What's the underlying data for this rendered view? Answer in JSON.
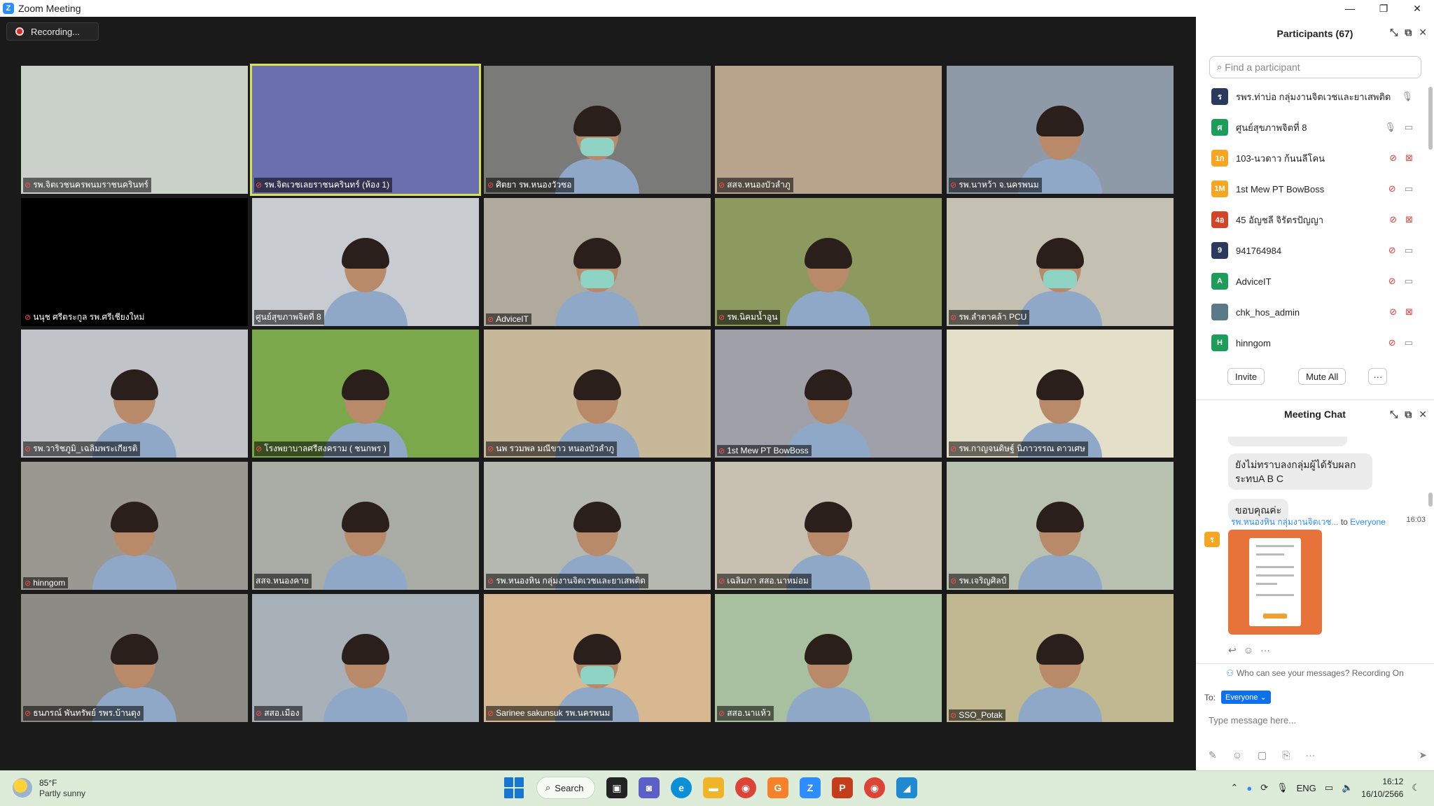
{
  "window": {
    "title": "Zoom Meeting",
    "controls": [
      "—",
      "❐",
      "✕"
    ]
  },
  "recording": {
    "label": "Recording..."
  },
  "tiles": [
    {
      "name": "รพ.จิตเวชนครพนมราชนครินทร์",
      "muted": true,
      "bg": "#c9d1c8",
      "person": false,
      "active": false
    },
    {
      "name": "รพ.จิตเวชเลยราชนครินทร์ (ห้อง 1)",
      "muted": true,
      "bg": "#6a6fb0",
      "person": false,
      "active": true
    },
    {
      "name": "ศิตยา รพ.หนองวัวซอ",
      "muted": true,
      "bg": "#7a7a78",
      "person": true,
      "mask": true,
      "active": false
    },
    {
      "name": "สสจ.หนองบัวลำภู",
      "muted": true,
      "bg": "#b8a48c",
      "person": false,
      "active": false
    },
    {
      "name": "รพ.นาหว้า จ.นครพนม",
      "muted": true,
      "bg": "#8f9aa8",
      "person": true,
      "mask": false,
      "active": false
    },
    {
      "name": "นนุช ศรีตระกูล รพ.ศรีเชียงใหม่",
      "muted": true,
      "bg": "#000000",
      "person": false,
      "active": false
    },
    {
      "name": "ศูนย์สุขภาพจิตที่ 8",
      "muted": false,
      "bg": "#c8ccd0",
      "person": true,
      "mask": false,
      "active": false
    },
    {
      "name": "AdviceIT",
      "muted": true,
      "bg": "#b0aa9c",
      "person": true,
      "mask": true,
      "active": false
    },
    {
      "name": "รพ.นิคมน้ำอูน",
      "muted": true,
      "bg": "#8c9a60",
      "person": true,
      "mask": false,
      "active": false
    },
    {
      "name": "รพ.ลำตาคล้า PCU",
      "muted": true,
      "bg": "#c4c0b2",
      "person": true,
      "mask": true,
      "active": false
    },
    {
      "name": "รพ.วาริชภูมิ_เฉลิมพระเกียรติ",
      "muted": true,
      "bg": "#c0c4c8",
      "person": true,
      "mask": false,
      "active": false
    },
    {
      "name": "โรงพยาบาลศรีสงคราม ( ชนกพร )",
      "muted": true,
      "bg": "#7aa84a",
      "person": true,
      "mask": false,
      "active": false
    },
    {
      "name": "นพ รวมพล มณีขาว หนองบัวลำภู",
      "muted": true,
      "bg": "#c8b89a",
      "person": true,
      "mask": false,
      "active": false
    },
    {
      "name": "1st Mew PT BowBoss",
      "muted": true,
      "bg": "#a0a0a8",
      "person": true,
      "mask": false,
      "active": false
    },
    {
      "name": "รพ.กาญจนดิษฐ์ นิภาวรรณ ดาวเศษ",
      "muted": true,
      "bg": "#e4dfc8",
      "person": true,
      "mask": false,
      "active": false
    },
    {
      "name": "hinngom",
      "muted": true,
      "bg": "#9a9890",
      "person": true,
      "mask": false,
      "active": false
    },
    {
      "name": "สสจ.หนองคาย",
      "muted": false,
      "bg": "#a8aca4",
      "person": true,
      "mask": false,
      "active": false
    },
    {
      "name": "รพ.หนองหิน กลุ่มงานจิตเวชและยาเสพติด",
      "muted": true,
      "bg": "#b4b8b0",
      "person": true,
      "mask": false,
      "active": false
    },
    {
      "name": "เฉลิมภา สสอ.นาหม่อม",
      "muted": true,
      "bg": "#c8c0b0",
      "person": true,
      "mask": false,
      "active": false
    },
    {
      "name": "รพ.เจริญศิลป์",
      "muted": true,
      "bg": "#b8c0b0",
      "person": true,
      "mask": false,
      "active": false
    },
    {
      "name": "ธนภรณ์ พันทรัพย์ รพร.บ้านดุง",
      "muted": true,
      "bg": "#8c8a84",
      "person": true,
      "mask": false,
      "active": false
    },
    {
      "name": "สสอ.เมือง",
      "muted": true,
      "bg": "#a8b0b8",
      "person": true,
      "mask": false,
      "active": false
    },
    {
      "name": "Sarinee sakunsuk รพ.นครพนม",
      "muted": true,
      "bg": "#d8b890",
      "person": true,
      "mask": true,
      "active": false
    },
    {
      "name": "สสอ.นาแห้ว",
      "muted": true,
      "bg": "#a8c0a0",
      "person": true,
      "mask": false,
      "active": false
    },
    {
      "name": "SSO_Potak",
      "muted": true,
      "bg": "#c0b890",
      "person": true,
      "mask": false,
      "active": false
    }
  ],
  "participants": {
    "title": "Participants (67)",
    "search_placeholder": "Find a participant",
    "list": [
      {
        "avatar": "ร",
        "color": "#2b3a5c",
        "name": "รพร.ท่าบ่อ กลุ่มงานจิตเวชและยาเสพติด",
        "mic": "on",
        "cam": "none"
      },
      {
        "avatar": "ศ",
        "color": "#1d9c5a",
        "name": "ศูนย์สุขภาพจิตที่ 8",
        "mic": "on",
        "cam": "on"
      },
      {
        "avatar": "1ก",
        "color": "#f5a623",
        "name": "103-นวดาว ก้นนลีโคน",
        "mic": "off",
        "cam": "off"
      },
      {
        "avatar": "1M",
        "color": "#f5a623",
        "name": "1st Mew PT BowBoss",
        "mic": "off",
        "cam": "on"
      },
      {
        "avatar": "4อ",
        "color": "#d0442a",
        "name": "45 อัญชลี จิรัตรปัญญา",
        "mic": "off",
        "cam": "off"
      },
      {
        "avatar": "9",
        "color": "#2b3a5c",
        "name": "941764984",
        "mic": "off",
        "cam": "on"
      },
      {
        "avatar": "A",
        "color": "#1d9c5a",
        "name": "AdviceIT",
        "mic": "off",
        "cam": "on"
      },
      {
        "avatar": "",
        "color": "#5a7a8a",
        "name": "chk_hos_admin",
        "mic": "off",
        "cam": "off"
      },
      {
        "avatar": "H",
        "color": "#1d9c5a",
        "name": "hinngom",
        "mic": "off",
        "cam": "on"
      }
    ],
    "invite_label": "Invite",
    "mute_all_label": "Mute All",
    "more_label": "···"
  },
  "chat": {
    "title": "Meeting Chat",
    "msg1": "ยังไม่ทราบลงกลุ่มผู้ได้รับผลกระทบA B C",
    "msg2": "ขอบคุณค่ะ",
    "sender": "รพ.หนองหิน กลุ่มงานจิตเวช...",
    "to_text": "to",
    "to_everyone": "Everyone",
    "time": "16:03",
    "sender_avatar": "ร",
    "privacy": "Who can see your messages? Recording On",
    "to_label": "To:",
    "to_value": "Everyone ⌄",
    "input_placeholder": "Type message here..."
  },
  "taskbar": {
    "temp": "85°F",
    "weather": "Partly sunny",
    "search_label": "Search",
    "lang": "ENG",
    "time": "16:12",
    "date": "16/10/2566"
  }
}
